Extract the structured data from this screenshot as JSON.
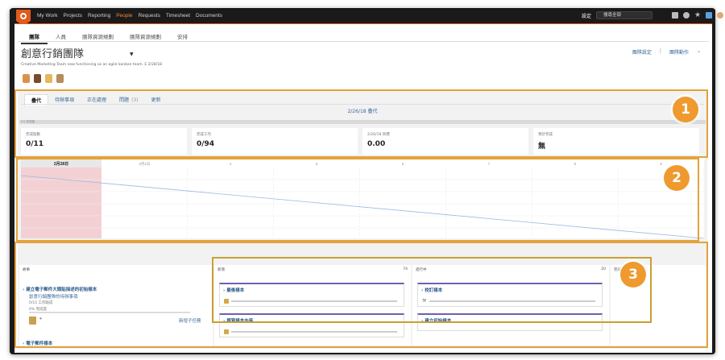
{
  "topbar": {
    "nav": [
      "My Work",
      "Projects",
      "Reporting",
      "People",
      "Requests",
      "Timesheet",
      "Documents"
    ],
    "active_nav": "People",
    "setup_label": "設定",
    "search_placeholder": "搜尋全部"
  },
  "subtabs": [
    "團隊",
    "人員",
    "團隊資源規劃",
    "團隊資源規劃",
    "安排"
  ],
  "header": {
    "title": "創意行銷團隊",
    "subtitle": "Creative Marketing Team now functioning as an agile kanban team. E 2/28/18",
    "action_settings": "團隊設定",
    "action_team": "團隊動作"
  },
  "panel": {
    "tabs": [
      {
        "label": "疊代",
        "count": ""
      },
      {
        "label": "待辦事項",
        "count": ""
      },
      {
        "label": "正在處理",
        "count": ""
      },
      {
        "label": "問題",
        "count": "(3)"
      },
      {
        "label": "更新",
        "count": ""
      }
    ],
    "iteration_name": "2/26/18 疊代",
    "progress_label": "0% 完成度",
    "stats": [
      {
        "label": "完成點數",
        "value": "0/11"
      },
      {
        "label": "完成工作",
        "value": "0/94"
      },
      {
        "label": "2/26/18 目標",
        "value": "0.00"
      },
      {
        "label": "預計完成",
        "value": "無"
      }
    ],
    "chart_dates": [
      "2月28日",
      "3月1日",
      "2",
      "5",
      "6",
      "7",
      "8",
      "9"
    ]
  },
  "columns": {
    "backlog": {
      "title": "故事",
      "story_title": "建立電子郵件大頭貼描述的初始樣本",
      "story_sub": "創意行銷團隊的待辦事項",
      "story_meta": "0/15 工作點成",
      "story_progress": "0% 完成度",
      "add_subtask": "新增子任務",
      "story2_title": "電子郵件樣本"
    },
    "todo": {
      "title": "新增",
      "count": "74",
      "cards": [
        "最後樣本",
        "撰寫樣本內容"
      ]
    },
    "doing": {
      "title": "進行中",
      "count": "20",
      "cards": [
        "校訂樣本",
        "建立初始樣本"
      ]
    },
    "done": {
      "title": "完成"
    }
  },
  "annotations": [
    "1",
    "2",
    "3"
  ],
  "colors": {
    "topbar": "#1a1a1a",
    "accent": "#e25a1c",
    "link": "#3a6a9a",
    "card_top": "#7060b0",
    "annotation": "#e3a23a",
    "badge": "#ee9a2f",
    "burndown_line": "#9ab8e0",
    "burndown_highlight": "#f3d0d4"
  }
}
